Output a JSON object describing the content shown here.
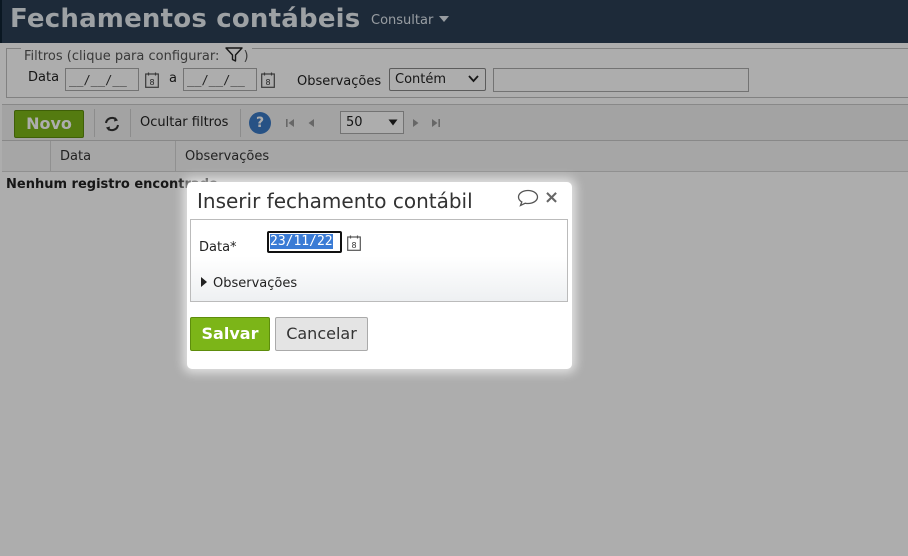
{
  "header": {
    "title": "Fechamentos contábeis",
    "menu_consultar": "Consultar"
  },
  "filters": {
    "legend": "Filtros (clique para configurar:",
    "legend_close": ")",
    "data_label": "Data",
    "date_from_placeholder": "__/__/__",
    "between_label": "a",
    "date_to_placeholder": "__/__/__",
    "observacoes_label": "Observações",
    "operator_selected": "Contém",
    "observacoes_value": ""
  },
  "toolbar": {
    "novo_label": "Novo",
    "ocultar_filtros_label": "Ocultar filtros",
    "help_label": "?",
    "page_size": "50"
  },
  "table": {
    "columns": [
      "Data",
      "Observações"
    ],
    "empty_message": "Nenhum registro encontrado"
  },
  "dialog": {
    "title": "Inserir fechamento contábil",
    "data_label": "Data*",
    "data_value": "23/11/22",
    "observacoes_expander": "Observações",
    "save_label": "Salvar",
    "cancel_label": "Cancelar",
    "close_symbol": "×"
  },
  "colors": {
    "header_bg": "#2b3f55",
    "primary_green": "#7cb518",
    "selection_blue": "#3a7bd5",
    "help_blue": "#3a79c5"
  },
  "icons": [
    "filter-icon",
    "calendar-icon",
    "refresh-icon",
    "help-icon",
    "first-page-icon",
    "prev-page-icon",
    "next-page-icon",
    "last-page-icon",
    "chat-icon",
    "close-icon",
    "expand-triangle-icon",
    "chevron-down-icon"
  ]
}
